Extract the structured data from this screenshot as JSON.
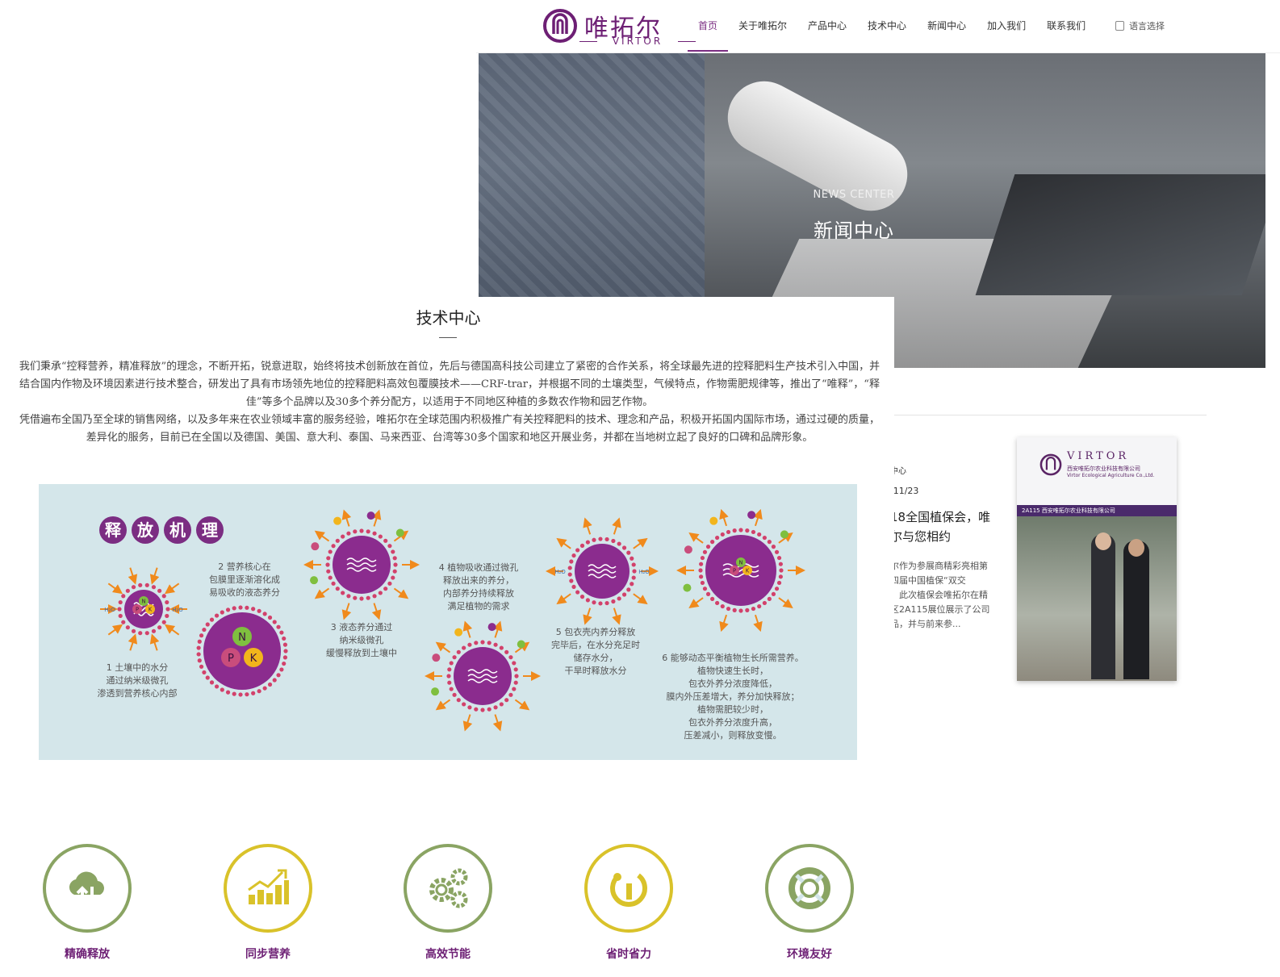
{
  "back": {
    "logo": {
      "cn": "唯拓尔",
      "en": "VIRTOR"
    },
    "nav": [
      "首页",
      "关于唯拓尔",
      "产品中心",
      "技术中心",
      "新闻中心",
      "加入我们",
      "联系我们"
    ],
    "lang_label": "语言选择",
    "hero": {
      "subtitle": "NEWS CENTER",
      "title": "新闻中心"
    },
    "news": {
      "category": "中心",
      "date": "/11/23",
      "title": "18全国植保会，唯\n尔与您相约",
      "desc": "尔作为参展商精彩亮相第\n四届中国植保“双交\n。此次植保会唯拓尔在精\n区2A115展位展示了公司\n品，并与前来参...",
      "photo": {
        "brand": "VIRTOR",
        "company_cn": "西安唯拓尔农业科技有限公司",
        "company_en": "Virtor Ecological Agriculture Co.,Ltd.",
        "booth_bar": "2A115    西安唯拓尔农业科技有限公司"
      }
    }
  },
  "front": {
    "title": "技术中心",
    "para1": "我们秉承“控释营养，精准释放”的理念，不断开拓，锐意进取，始终将技术创新放在首位，先后与德国高科技公司建立了紧密的合作关系，将全球最先进的控释肥料生产技术引入中国，并结合国内作物及环境因素进行技术整合，研发出了具有市场领先地位的控释肥料高效包覆膜技术——CRF-trar，并根据不同的土壤类型，气候特点，作物需肥规律等，推出了“唯释”，“释佳”等多个品牌以及30多个养分配方，以适用于不同地区种植的多数农作物和园艺作物。",
    "para2": "凭借遍布全国乃至全球的销售网络，以及多年来在农业领域丰富的服务经验，唯拓尔在全球范围内积极推广有关控释肥料的技术、理念和产品，积极开拓国内国际市场，通过过硬的质量，差异化的服务，目前已在全国以及德国、美国、意大利、泰国、马来西亚、台湾等30多个国家和地区开展业务，并都在当地树立起了良好的口碑和品牌形象。",
    "mechanism": {
      "heading": [
        "释",
        "放",
        "机",
        "理"
      ],
      "steps": [
        "1 土壤中的水分\n通过纳米级微孔\n渗透到营养核心内部",
        "2 营养核心在\n包膜里逐渐溶化成\n易吸收的液态养分",
        "3 液态养分通过\n纳米级微孔\n缓慢释放到土壤中",
        "4 植物吸收通过微孔\n释放出来的养分，\n内部养分持续释放\n满足植物的需求",
        "5 包衣壳内养分释放\n完毕后，在水分充足时\n储存水分，\n干旱时释放水分",
        "6 能够动态平衡植物生长所需营养。\n植物快速生长时，\n包衣外养分浓度降低，\n膜内外压差增大，养分加快释放；\n植物需肥较少时，\n包衣外养分浓度升高，\n压差减小，则释放变慢。"
      ],
      "nutrients": [
        "N",
        "P",
        "K"
      ],
      "water": "H₂O"
    },
    "features": [
      {
        "label": "精确释放",
        "icon": "cloud-arrows-icon",
        "color": "#8aa463"
      },
      {
        "label": "同步营养",
        "icon": "bar-chart-icon",
        "color": "#d9c22a"
      },
      {
        "label": "高效节能",
        "icon": "gears-icon",
        "color": "#8aa463"
      },
      {
        "label": "省时省力",
        "icon": "power-icon",
        "color": "#d9c22a"
      },
      {
        "label": "环境友好",
        "icon": "lifebuoy-icon",
        "color": "#8aa463"
      }
    ]
  }
}
